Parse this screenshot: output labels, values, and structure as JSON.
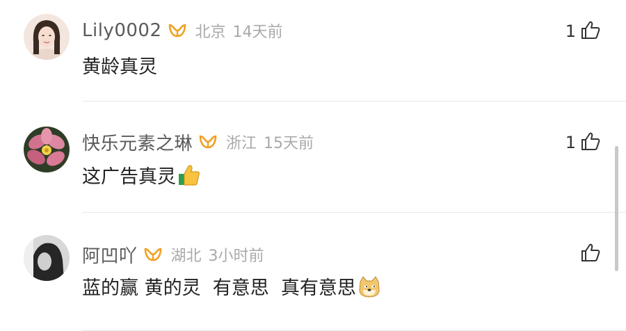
{
  "comments": [
    {
      "username": "Lily0002",
      "location": "北京",
      "time": "14天前",
      "text": "黄龄真灵",
      "likes": "1",
      "avatar": "woman-portrait-avatar",
      "emoji": ""
    },
    {
      "username": "快乐元素之琳",
      "location": "浙江",
      "time": "15天前",
      "text": "这广告真灵",
      "likes": "1",
      "avatar": "pink-flower-avatar",
      "emoji": "thumbs-up-emoji"
    },
    {
      "username": "阿凹吖",
      "location": "湖北",
      "time": "3小时前",
      "text": "蓝的赢 黄的灵  有意思  真有意思",
      "likes": "",
      "avatar": "dark-hair-avatar",
      "emoji": "doge-emoji"
    }
  ],
  "colors": {
    "vip_badge": "#f0a020",
    "username": "#5a5a5a",
    "meta": "#a9a9a9",
    "text": "#222222"
  }
}
